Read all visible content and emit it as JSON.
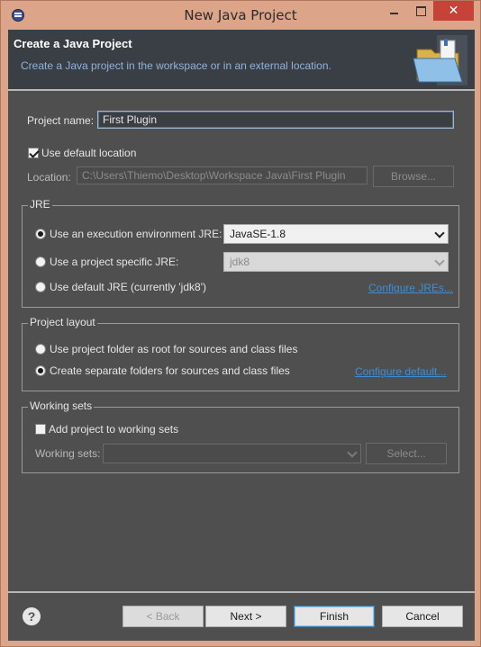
{
  "window": {
    "title": "New Java Project",
    "close_glyph": "✕"
  },
  "header": {
    "title": "Create a Java Project",
    "description": "Create a Java project in the workspace or in an external location.",
    "icon": "open-folder-icon"
  },
  "project": {
    "name_label": "Project name:",
    "name_value": "First Plugin",
    "use_default_location_label": "Use default location",
    "use_default_location_checked": true,
    "location_label": "Location:",
    "location_value": "C:\\Users\\Thiemo\\Desktop\\Workspace Java\\First Plugin",
    "browse_label": "Browse..."
  },
  "jre": {
    "group_title": "JRE",
    "options": [
      {
        "label": "Use an execution environment JRE:",
        "selected": true
      },
      {
        "label": "Use a project specific JRE:",
        "selected": false
      },
      {
        "label": "Use default JRE (currently 'jdk8')",
        "selected": false
      }
    ],
    "execution_env_value": "JavaSE-1.8",
    "project_specific_value": "jdk8",
    "configure_link": "Configure JREs..."
  },
  "layout": {
    "group_title": "Project layout",
    "options": [
      {
        "label": "Use project folder as root for sources and class files",
        "selected": false
      },
      {
        "label": "Create separate folders for sources and class files",
        "selected": true
      }
    ],
    "configure_link": "Configure default..."
  },
  "working_sets": {
    "group_title": "Working sets",
    "add_label": "Add project to working sets",
    "add_checked": false,
    "sets_label": "Working sets:",
    "sets_value": "",
    "select_label": "Select..."
  },
  "footer": {
    "help_glyph": "?",
    "back_label": "< Back",
    "next_label": "Next >",
    "finish_label": "Finish",
    "cancel_label": "Cancel"
  },
  "colors": {
    "dialog_bg": "#4f4f4f",
    "header_bg": "#3a3f46",
    "window_frame": "#dca488",
    "link": "#3c8fd6",
    "close_button": "#c7433a"
  }
}
